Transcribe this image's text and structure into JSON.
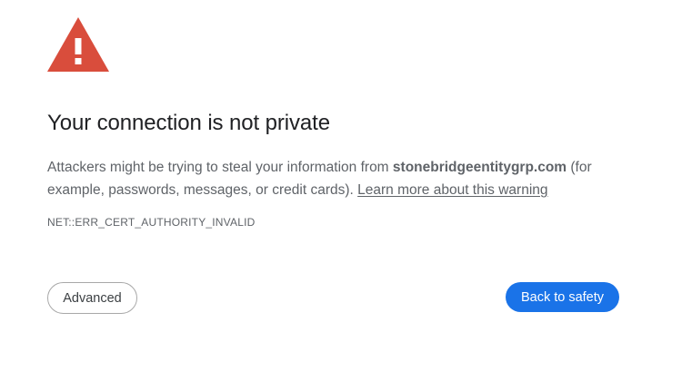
{
  "warning": {
    "icon": "warning-triangle-icon",
    "icon_color": "#d94d3c"
  },
  "title": "Your connection is not private",
  "message": {
    "prefix": "Attackers might be trying to steal your information from ",
    "domain": "stonebridgeentitygrp.com",
    "suffix": " (for example, passwords, messages, or credit cards). ",
    "link": "Learn more about this warning"
  },
  "error_code": "NET::ERR_CERT_AUTHORITY_INVALID",
  "buttons": {
    "advanced": "Advanced",
    "back_to_safety": "Back to safety"
  },
  "colors": {
    "primary_button": "#1a73e8",
    "text_secondary": "#5f6368",
    "text_primary": "#202124"
  }
}
